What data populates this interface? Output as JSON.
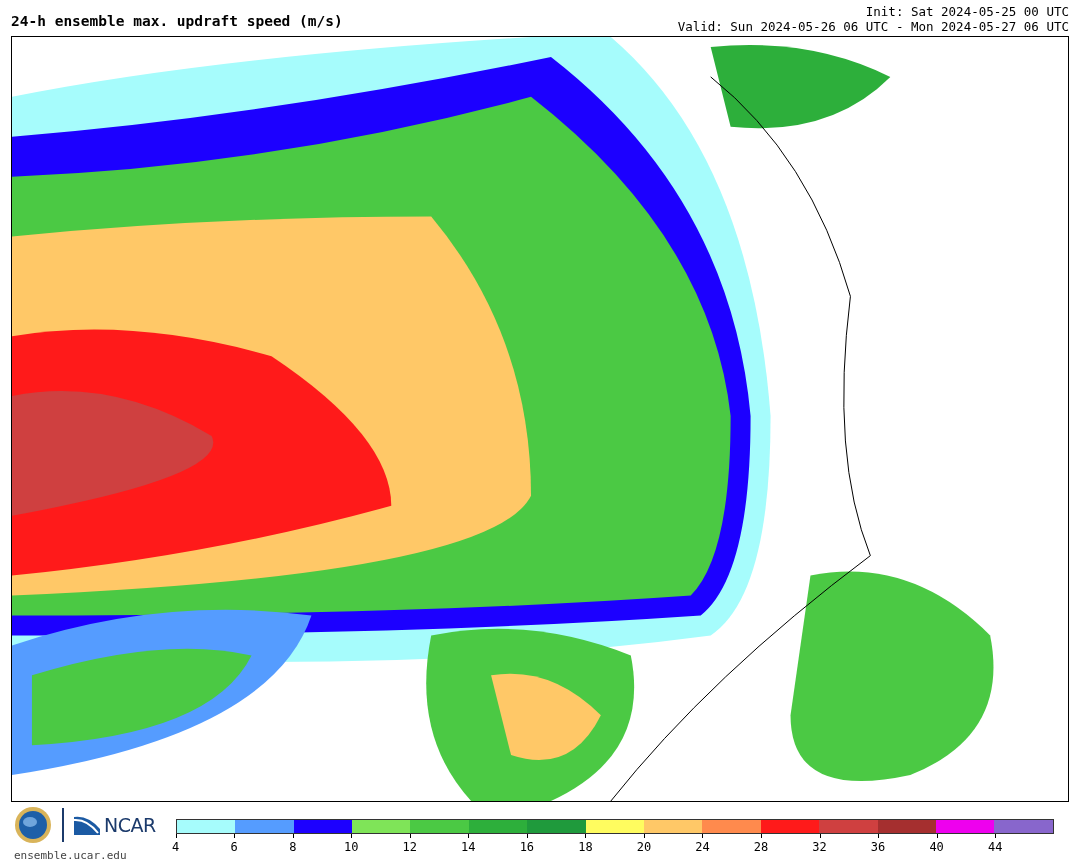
{
  "title": "24-h ensemble max. updraft speed (m/s)",
  "init": "Init: Sat 2024-05-25 00 UTC",
  "valid": "Valid: Sun 2024-05-26 06 UTC - Mon 2024-05-27 06 UTC",
  "footer": {
    "logo_text": "NCAR",
    "url": "ensemble.ucar.edu"
  },
  "colorbar": {
    "segments": [
      {
        "color": "#a6fcfc",
        "tick": "4"
      },
      {
        "color": "#559cff",
        "tick": "6"
      },
      {
        "color": "#1c00ff",
        "tick": "8"
      },
      {
        "color": "#7fe458",
        "tick": "10"
      },
      {
        "color": "#4bc944",
        "tick": "12"
      },
      {
        "color": "#2daf3b",
        "tick": "14"
      },
      {
        "color": "#1f9a3c",
        "tick": "16"
      },
      {
        "color": "#fffc5f",
        "tick": "18"
      },
      {
        "color": "#ffc867",
        "tick": "20"
      },
      {
        "color": "#ff8a4d",
        "tick": "24"
      },
      {
        "color": "#ff1a1a",
        "tick": "28"
      },
      {
        "color": "#cf4040",
        "tick": "32"
      },
      {
        "color": "#a52f2f",
        "tick": "36"
      },
      {
        "color": "#ee00ee",
        "tick": "40"
      },
      {
        "color": "#8866cc",
        "tick": "44"
      }
    ]
  }
}
